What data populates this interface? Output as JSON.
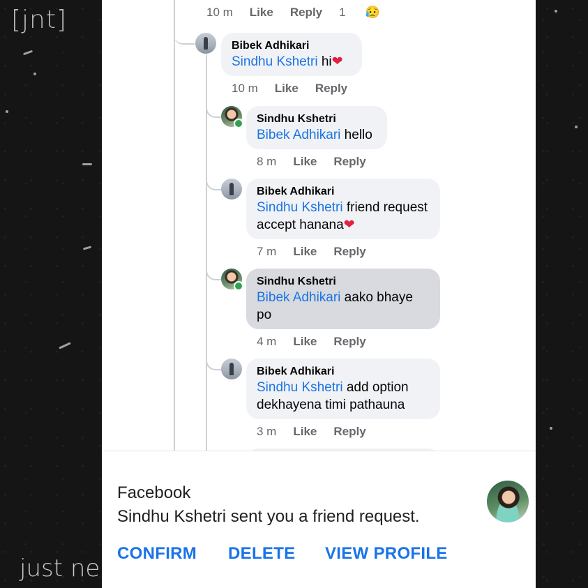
{
  "watermark": {
    "top": "[jnt]",
    "bottom": "just nepa"
  },
  "thread": {
    "top_meta": {
      "time": "10 m",
      "like": "Like",
      "reply": "Reply",
      "reaction_count": "1",
      "reaction_emoji": "😥"
    },
    "comments": [
      {
        "author": "Bibek Adhikari",
        "mention": "Sindhu Kshetri",
        "text_line1": " hi",
        "heart": "❤",
        "time": "10 m",
        "like": "Like",
        "reply": "Reply"
      },
      {
        "author": "Sindhu Kshetri",
        "mention": "Bibek Adhikari",
        "text_line1": " hello",
        "time": "8 m",
        "like": "Like",
        "reply": "Reply"
      },
      {
        "author": "Bibek Adhikari",
        "mention": "Sindhu Kshetri",
        "text_line1": " friend request",
        "text_line2": "accept hanana",
        "heart": "❤",
        "time": "7 m",
        "like": "Like",
        "reply": "Reply"
      },
      {
        "author": "Sindhu Kshetri",
        "mention": "Bibek Adhikari",
        "text_line1": " aako bhaye",
        "text_line2": "po",
        "time": "4 m",
        "like": "Like",
        "reply": "Reply"
      },
      {
        "author": "Bibek Adhikari",
        "mention": "Sindhu Kshetri",
        "text_line1": " add option",
        "text_line2": "dekhayena timi pathauna",
        "time": "3 m",
        "like": "Like",
        "reply": "Reply"
      }
    ]
  },
  "notification": {
    "app": "Facebook",
    "message": "Sindhu Kshetri sent you a friend request.",
    "confirm": "CONFIRM",
    "delete": "DELETE",
    "view_profile": "VIEW PROFILE"
  },
  "colors": {
    "mention": "#1b74e4",
    "action_blue": "#1a73e8",
    "online": "#31a24c",
    "bubble": "#f0f2f5"
  }
}
